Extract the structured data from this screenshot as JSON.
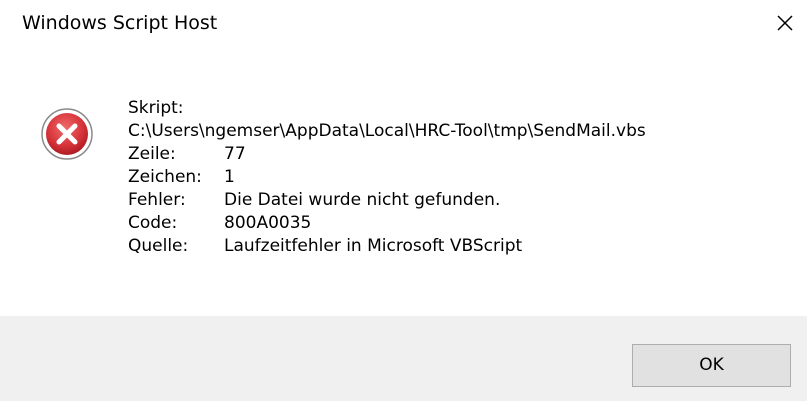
{
  "window": {
    "title": "Windows Script Host",
    "close_label": "×"
  },
  "icon": {
    "name": "error-icon",
    "color": "#c4262e"
  },
  "message": {
    "script_label": "Skript:",
    "script_path": "C:\\Users\\ngemser\\AppData\\Local\\HRC-Tool\\tmp\\SendMail.vbs",
    "rows": [
      {
        "label": "Zeile:",
        "value": "77"
      },
      {
        "label": "Zeichen:",
        "value": "1"
      },
      {
        "label": "Fehler:",
        "value": "Die Datei wurde nicht gefunden."
      },
      {
        "label": "Code:",
        "value": "800A0035"
      },
      {
        "label": "Quelle:",
        "value": "Laufzeitfehler in Microsoft VBScript"
      }
    ]
  },
  "buttons": {
    "ok_label": "OK"
  }
}
